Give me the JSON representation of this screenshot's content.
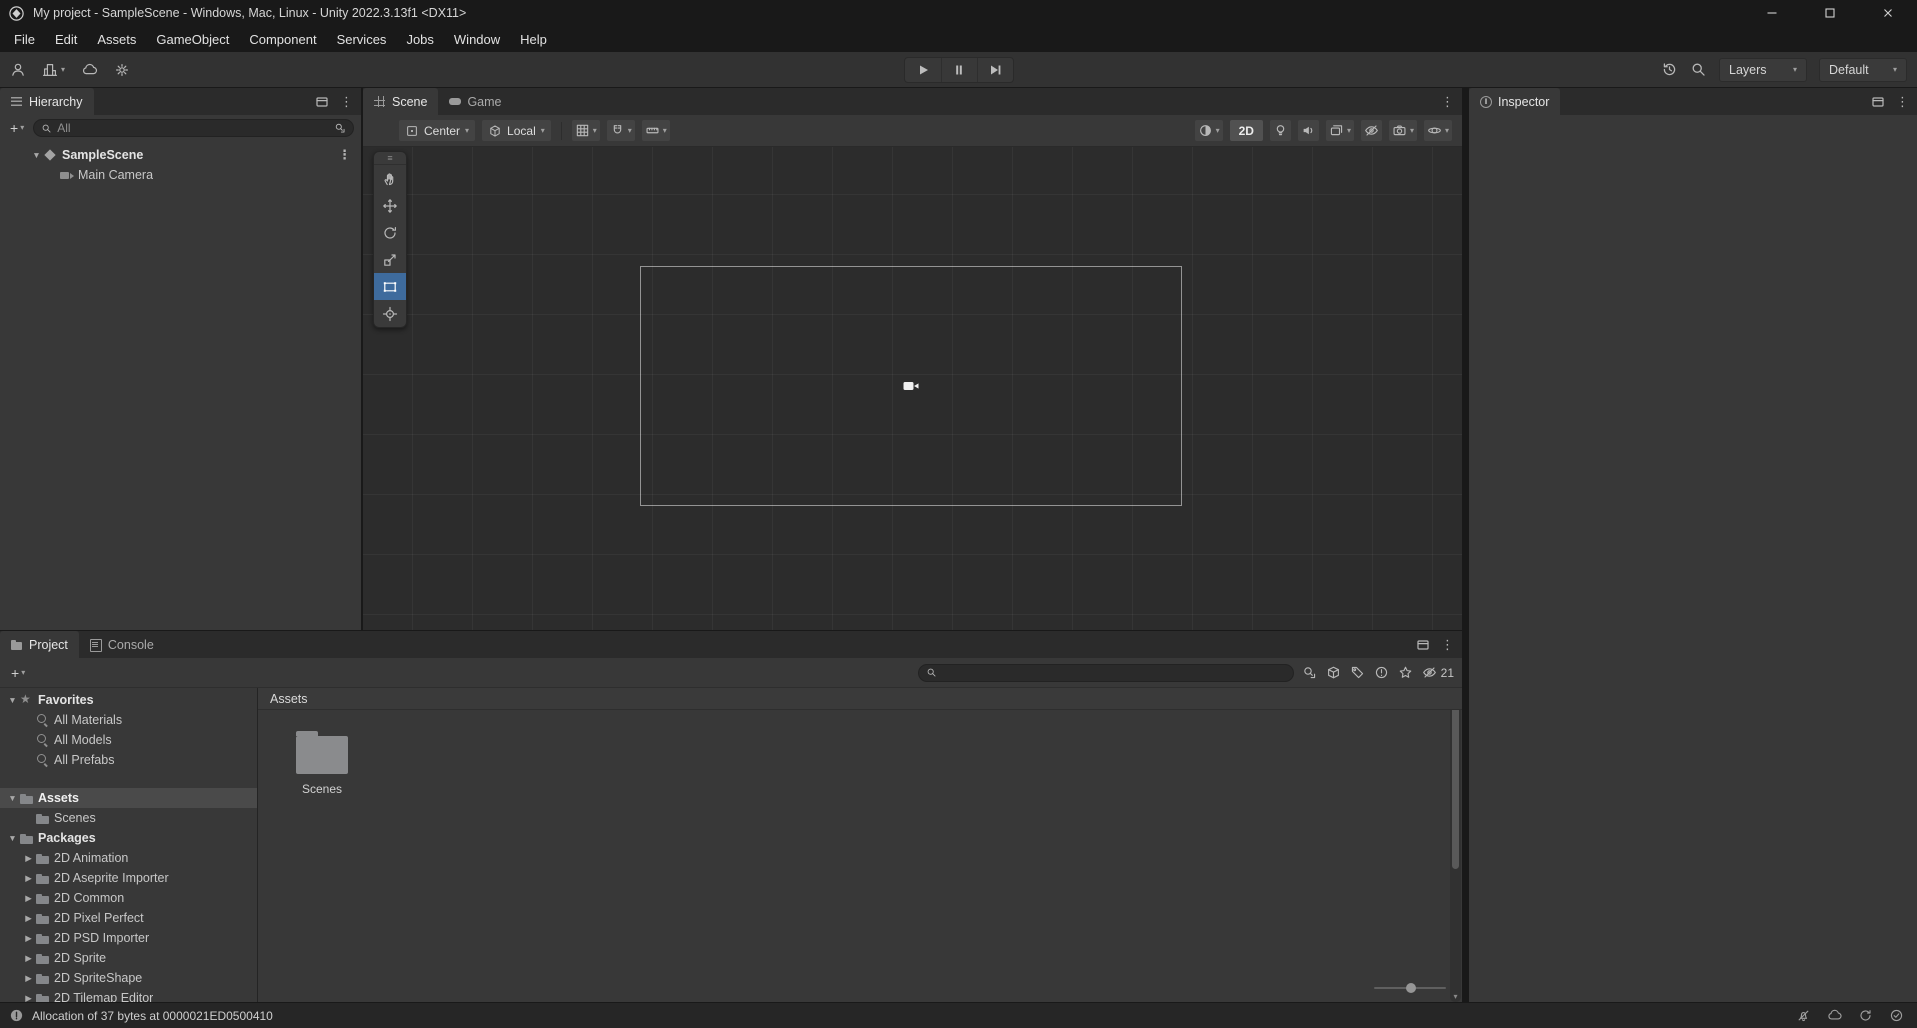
{
  "icons": {
    "chevron": "▾",
    "kebab": "⋮",
    "grip": "≡",
    "plus": "+",
    "scroll_down": "▾"
  },
  "titlebar": {
    "title": "My project - SampleScene - Windows, Mac, Linux - Unity 2022.3.13f1 <DX11>"
  },
  "menubar": {
    "items": [
      "File",
      "Edit",
      "Assets",
      "GameObject",
      "Component",
      "Services",
      "Jobs",
      "Window",
      "Help"
    ]
  },
  "toolbar": {
    "layers_label": "Layers",
    "layout_label": "Default"
  },
  "hierarchy": {
    "tab_label": "Hierarchy",
    "search_placeholder": "All",
    "rows": [
      {
        "label": "SampleScene",
        "foldout": "▼",
        "icon": "scene",
        "indent": 0,
        "cls": "bold",
        "kebab": "⋮"
      },
      {
        "label": "Main Camera",
        "foldout": "",
        "icon": "camera",
        "indent": 1
      }
    ]
  },
  "scene": {
    "tab_scene": "Scene",
    "tab_game": "Game",
    "pivot_label": "Center",
    "orientation_label": "Local",
    "mode2d_label": "2D"
  },
  "inspector": {
    "tab_label": "Inspector"
  },
  "project": {
    "tab_project": "Project",
    "tab_console": "Console",
    "search_placeholder": "",
    "breadcrumb": "Assets",
    "hidden_count": "21",
    "rows": [
      {
        "label": "Favorites",
        "foldout": "▼",
        "icon": "star",
        "indent": 0,
        "cls": "bold"
      },
      {
        "label": "All Materials",
        "foldout": "",
        "icon": "search",
        "indent": 1
      },
      {
        "label": "All Models",
        "foldout": "",
        "icon": "search",
        "indent": 1
      },
      {
        "label": "All Prefabs",
        "foldout": "",
        "icon": "search",
        "indent": 1
      },
      {
        "label": "",
        "foldout": "",
        "icon": "",
        "indent": 0,
        "cls": "spacer"
      },
      {
        "label": "Assets",
        "foldout": "▼",
        "icon": "folder",
        "indent": 0,
        "cls": "bold selected"
      },
      {
        "label": "Scenes",
        "foldout": "",
        "icon": "folder",
        "indent": 1
      },
      {
        "label": "Packages",
        "foldout": "▼",
        "icon": "folder",
        "indent": 0,
        "cls": "bold"
      },
      {
        "label": "2D Animation",
        "foldout": "▶",
        "icon": "folder",
        "indent": 1
      },
      {
        "label": "2D Aseprite Importer",
        "foldout": "▶",
        "icon": "folder",
        "indent": 1
      },
      {
        "label": "2D Common",
        "foldout": "▶",
        "icon": "folder",
        "indent": 1
      },
      {
        "label": "2D Pixel Perfect",
        "foldout": "▶",
        "icon": "folder",
        "indent": 1
      },
      {
        "label": "2D PSD Importer",
        "foldout": "▶",
        "icon": "folder",
        "indent": 1
      },
      {
        "label": "2D Sprite",
        "foldout": "▶",
        "icon": "folder",
        "indent": 1
      },
      {
        "label": "2D SpriteShape",
        "foldout": "▶",
        "icon": "folder",
        "indent": 1
      },
      {
        "label": "2D Tilemap Editor",
        "foldout": "▶",
        "icon": "folder",
        "indent": 1
      }
    ],
    "tiles": [
      {
        "label": "Scenes"
      }
    ]
  },
  "statusbar": {
    "message": "Allocation of 37 bytes at 0000021ED0500410"
  }
}
